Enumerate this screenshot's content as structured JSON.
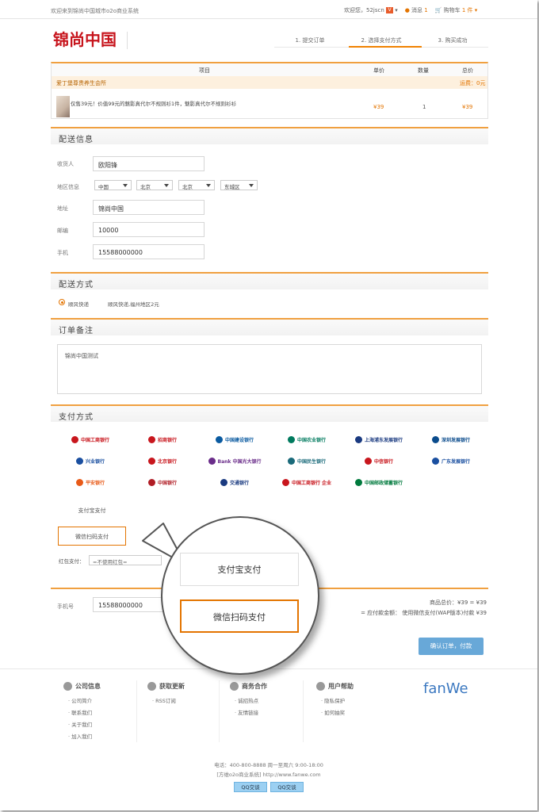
{
  "topbar": {
    "welcome": "欢迎来到锦尚中国城市o2o商业系统",
    "greeting": "欢迎您，52jscn",
    "message": "消息",
    "message_count": "1",
    "cart": "购物车",
    "cart_count": "1 件"
  },
  "logo": "锦尚中国",
  "steps": [
    "1. 提交订单",
    "2. 选择支付方式",
    "3. 购买成功"
  ],
  "cart_table": {
    "headers": [
      "项目",
      "单价",
      "数量",
      "总价"
    ],
    "shop": "爱丁堡尊贵养生会所",
    "shipping": "运费：0元",
    "item": {
      "name": "仅售39元！价值99元的魅影真代尔不规则衫1件，魅影真代尔不规则衫衫",
      "price": "¥39",
      "qty": "1",
      "total": "¥39"
    }
  },
  "delivery": {
    "title": "配送信息",
    "receiver_label": "收货人",
    "receiver": "欧阳锋",
    "region_label": "地区信息",
    "region": [
      "中国",
      "北京",
      "北京",
      "东城区"
    ],
    "address_label": "地址",
    "address": "锦尚中国",
    "zip_label": "邮编",
    "zip": "10000",
    "phone_label": "手机",
    "phone": "15588000000"
  },
  "shipping_method": {
    "title": "配送方式",
    "option": "顺风快递",
    "desc": "顺风快递,福州地区2元"
  },
  "remark": {
    "title": "订单备注",
    "value": "锦尚中国测试"
  },
  "payment": {
    "title": "支付方式",
    "banks": [
      {
        "label": "中国工商银行",
        "color": "#c8161d"
      },
      {
        "label": "招商银行",
        "color": "#c8161d"
      },
      {
        "label": "中国建设银行",
        "color": "#0a5aa0"
      },
      {
        "label": "中国农业银行",
        "color": "#007a5e"
      },
      {
        "label": "上海浦东发展银行",
        "color": "#1a3a80"
      },
      {
        "label": "深圳发展银行",
        "color": "#0a4b8c"
      },
      {
        "label": "兴业银行",
        "color": "#1a4fa0"
      },
      {
        "label": "北京银行",
        "color": "#c8161d"
      },
      {
        "label": "Bank 中国光大银行",
        "color": "#6a2d8a"
      },
      {
        "label": "中国民生银行",
        "color": "#1a6a7a"
      },
      {
        "label": "中信银行",
        "color": "#c8161d"
      },
      {
        "label": "广东发展银行",
        "color": "#1a4fa0"
      },
      {
        "label": "平安银行",
        "color": "#e85a18"
      },
      {
        "label": "中国银行",
        "color": "#b01c24"
      },
      {
        "label": "交通银行",
        "color": "#1a3a80"
      },
      {
        "label": "中国工商银行 企业",
        "color": "#c8161d"
      },
      {
        "label": "中国邮政储蓄银行",
        "color": "#007a3d"
      }
    ],
    "alipay": "支付宝支付",
    "wechat": "微信扫码支付",
    "hongbao_label": "红包支付：",
    "hongbao_select": "=不使用红包="
  },
  "summary": {
    "phone_label": "手机号",
    "phone": "15588000000",
    "goods_total": "商品总价：¥39 = ¥39",
    "pay_total": "= 应付款金额： 使用微信支付(WAP版本)付款 ¥39",
    "confirm": "确认订单，付款"
  },
  "zoom": {
    "alipay": "支付宝支付",
    "wechat": "微信扫码支付"
  },
  "footer": {
    "cols": [
      {
        "title": "公司信息",
        "links": [
          "公司简介",
          "联系我们",
          "关于我们",
          "加入我们"
        ]
      },
      {
        "title": "获取更新",
        "links": [
          "RSS订阅"
        ]
      },
      {
        "title": "商务合作",
        "links": [
          "诚招热点",
          "友情链接"
        ]
      },
      {
        "title": "用户帮助",
        "links": [
          "隐私保护",
          "如何抽奖"
        ]
      }
    ],
    "brand": "fanWe",
    "phone": "电话：400-800-8888 周一至周六 9:00-18:00",
    "company": "[方维o2o商业系统] http://www.fanwe.com",
    "qq1": "QQ交谈",
    "qq2": "QQ交谈"
  }
}
